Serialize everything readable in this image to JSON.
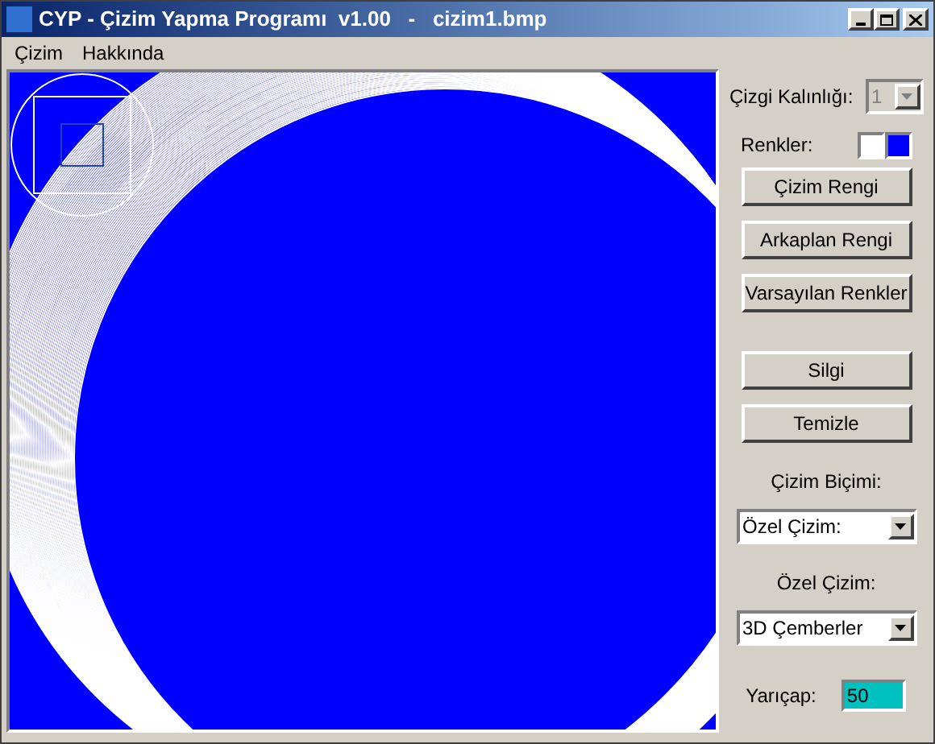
{
  "window": {
    "title": "CYP - Çizim Yapma Programı  v1.00   -   cizim1.bmp"
  },
  "menu": [
    "Çizim",
    "Hakkında"
  ],
  "line_width": {
    "label": "Çizgi Kalınlığı:",
    "value": "1",
    "disabled": true
  },
  "colors": {
    "label": "Renkler:",
    "swatches": [
      {
        "color": "#ffffff"
      },
      {
        "color": "#0000ff"
      }
    ]
  },
  "color_buttons": [
    "Çizim Rengi",
    "Arkaplan Rengi",
    "Varsayılan Renkler"
  ],
  "tool_buttons": [
    "Silgi",
    "Temizle"
  ],
  "draw_mode": {
    "label": "Çizim Biçimi:",
    "value": "Özel Çizim:"
  },
  "special_draw": {
    "label": "Özel Çizim:",
    "value": "3D Çemberler"
  },
  "radius": {
    "label": "Yarıçap:",
    "value": "50"
  }
}
